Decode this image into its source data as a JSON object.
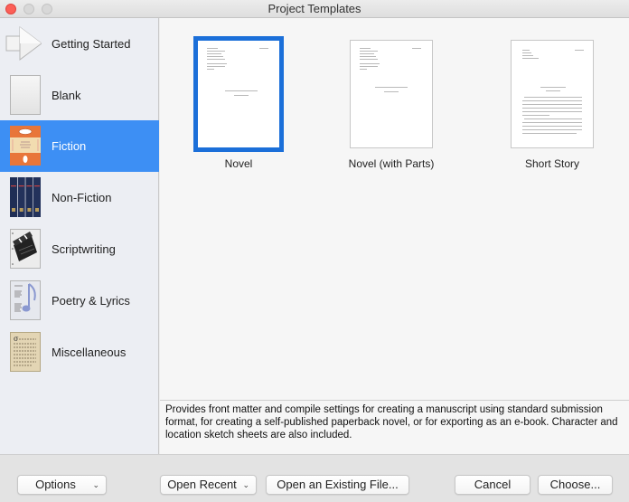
{
  "window": {
    "title": "Project Templates"
  },
  "sidebar": {
    "items": [
      {
        "label": "Getting Started",
        "icon": "arrow-icon",
        "selected": false
      },
      {
        "label": "Blank",
        "icon": "blank-page-icon",
        "selected": false
      },
      {
        "label": "Fiction",
        "icon": "penguin-book-icon",
        "selected": true
      },
      {
        "label": "Non-Fiction",
        "icon": "book-volumes-icon",
        "selected": false
      },
      {
        "label": "Scriptwriting",
        "icon": "clapperboard-icon",
        "selected": false
      },
      {
        "label": "Poetry & Lyrics",
        "icon": "music-note-page-icon",
        "selected": false
      },
      {
        "label": "Miscellaneous",
        "icon": "parchment-page-icon",
        "selected": false
      }
    ]
  },
  "templates": [
    {
      "label": "Novel",
      "selected": true
    },
    {
      "label": "Novel (with Parts)",
      "selected": false
    },
    {
      "label": "Short Story",
      "selected": false
    }
  ],
  "description": "Provides front matter and compile settings for creating a manuscript using standard submission format, for creating a self-published paperback novel, or for exporting as an e-book. Character and location sketch sheets are also included.",
  "buttons": {
    "options": "Options",
    "open_recent": "Open Recent",
    "open_existing": "Open an Existing File...",
    "cancel": "Cancel",
    "choose": "Choose..."
  },
  "colors": {
    "selection": "#3d8ff4",
    "thumb_selection": "#1b6fd9",
    "close_button": "#fc5f57"
  }
}
